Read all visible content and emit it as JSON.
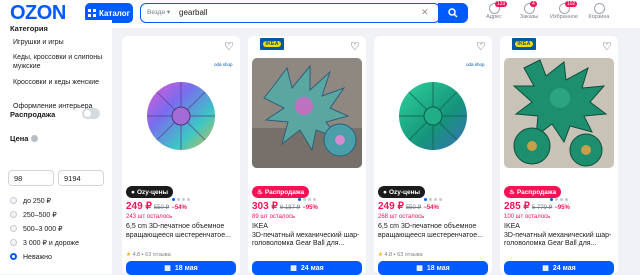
{
  "header": {
    "logo": "OZON",
    "catalog": "Каталог",
    "search_scope": "Везде",
    "search_value": "gearball",
    "icons": [
      {
        "label": "Адрес",
        "badge": "133",
        "icon": "location-icon"
      },
      {
        "label": "Заказы",
        "badge": "4",
        "icon": "box-icon"
      },
      {
        "label": "Избранное",
        "badge": "102",
        "icon": "heart-icon"
      },
      {
        "label": "Корзина",
        "badge": "",
        "icon": "cart-icon"
      }
    ]
  },
  "sidebar": {
    "title": "Категория",
    "categories": [
      "Игрушки и игры",
      "Кеды, кроссовки и слипоны мужские",
      "Кроссовки и кеды женские",
      "Оформление интерьера"
    ],
    "sale": "Распродажа",
    "price_title": "Цена",
    "price_from": "98",
    "price_to": "9194",
    "ranges": [
      "до 250 ₽",
      "250–500 ₽",
      "500–3 000 ₽",
      "3 000 ₽ и дороже",
      "Неважно"
    ]
  },
  "products": [
    {
      "ikea": false,
      "promo": "Ozy-цены",
      "promo_style": "dark",
      "price": "249 ₽",
      "old": "550 ₽",
      "disc": "−54%",
      "left": "243 шт осталось",
      "name": "6,5 cm 3D-печатное объемное вращающееся шестеренчатое...",
      "brand": "",
      "rating": "4.8",
      "reviews": "63 отзыва",
      "delivery": "18 мая",
      "seller_tag": "oda shop",
      "img": "rainbow"
    },
    {
      "ikea": true,
      "promo": "Распродажа",
      "promo_style": "pink",
      "price": "303 ₽",
      "old": "6 187 ₽",
      "disc": "−95%",
      "left": "89 шт осталось",
      "name": "3D-печатный механический шар-головоломка Gear Ball для...",
      "brand": "IKEA",
      "rating": "",
      "reviews": "",
      "delivery": "24 мая",
      "seller_tag": "",
      "img": "photo1"
    },
    {
      "ikea": false,
      "promo": "Ozy-цены",
      "promo_style": "dark",
      "price": "249 ₽",
      "old": "550 ₽",
      "disc": "−54%",
      "left": "268 шт осталось",
      "name": "6,5 cm 3D-печатное объемное вращающееся шестеренчатое...",
      "brand": "",
      "rating": "4.8",
      "reviews": "63 отзыва",
      "delivery": "18 мая",
      "seller_tag": "oda shop",
      "img": "green"
    },
    {
      "ikea": true,
      "promo": "Распродажа",
      "promo_style": "pink",
      "price": "285 ₽",
      "old": "5 779 ₽",
      "disc": "−95%",
      "left": "100 шт осталось",
      "name": "3D-печатный механический шар-головоломка Gear Ball для...",
      "brand": "IKEA",
      "rating": "",
      "reviews": "",
      "delivery": "24 мая",
      "seller_tag": "",
      "img": "photo2"
    }
  ]
}
